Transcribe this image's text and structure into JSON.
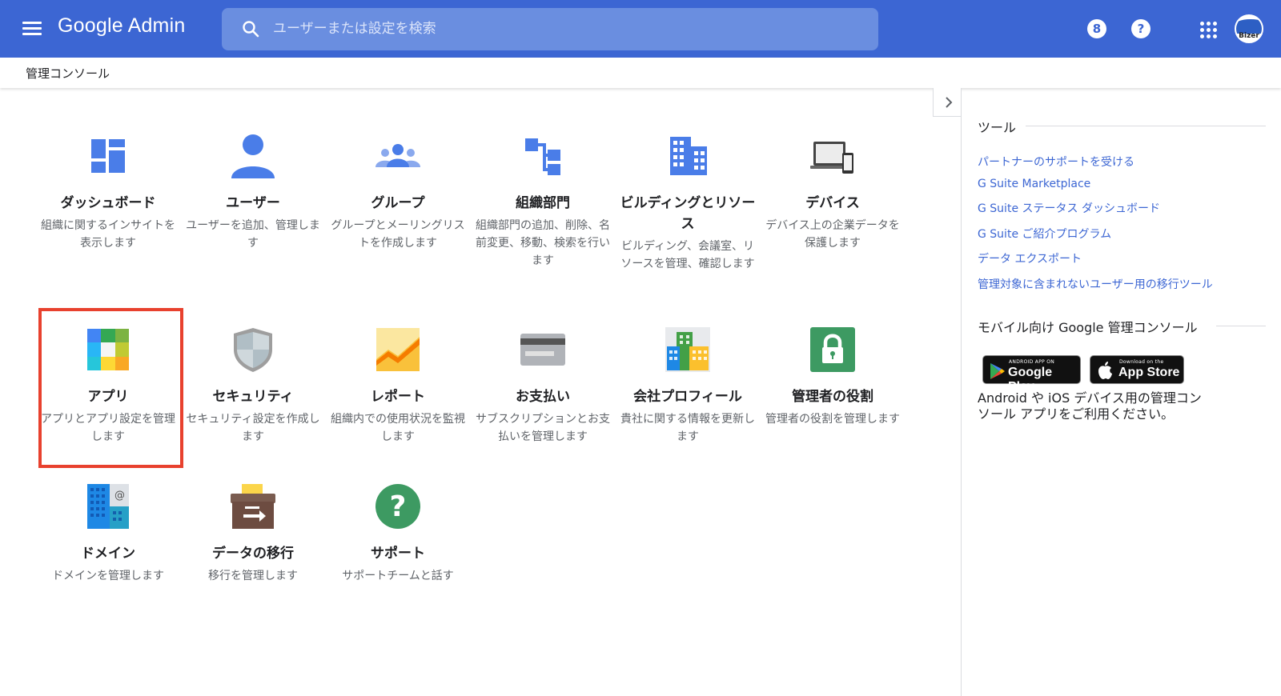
{
  "header": {
    "app_name": "Google Admin",
    "search_placeholder": "ユーザーまたは設定を検索",
    "notification_count": "8",
    "help_label": "?",
    "avatar_text": "Bizer"
  },
  "breadcrumb": "管理コンソール",
  "cards": [
    {
      "icon": "dashboard-icon",
      "title": "ダッシュボード",
      "desc": "組織に関するインサイトを表示します"
    },
    {
      "icon": "user-icon",
      "title": "ユーザー",
      "desc": "ユーザーを追加、管理します"
    },
    {
      "icon": "group-icon",
      "title": "グループ",
      "desc": "グループとメーリングリストを作成します"
    },
    {
      "icon": "org-unit-icon",
      "title": "組織部門",
      "desc": "組織部門の追加、削除、名前変更、移動、検索を行います"
    },
    {
      "icon": "building-icon",
      "title": "ビルディングとリソース",
      "desc": "ビルディング、会議室、リソースを管理、確認します"
    },
    {
      "icon": "devices-icon",
      "title": "デバイス",
      "desc": "デバイス上の企業データを保護します"
    },
    {
      "icon": "apps-icon",
      "title": "アプリ",
      "desc": "アプリとアプリ設定を管理します"
    },
    {
      "icon": "security-shield-icon",
      "title": "セキュリティ",
      "desc": "セキュリティ設定を作成します"
    },
    {
      "icon": "reports-chart-icon",
      "title": "レポート",
      "desc": "組織内での使用状況を監視します"
    },
    {
      "icon": "billing-card-icon",
      "title": "お支払い",
      "desc": "サブスクリプションとお支払いを管理します"
    },
    {
      "icon": "company-profile-icon",
      "title": "会社プロフィール",
      "desc": "貴社に関する情報を更新します"
    },
    {
      "icon": "admin-roles-lock-icon",
      "title": "管理者の役割",
      "desc": "管理者の役割を管理します"
    },
    {
      "icon": "domains-icon",
      "title": "ドメイン",
      "desc": "ドメインを管理します"
    },
    {
      "icon": "data-migration-icon",
      "title": "データの移行",
      "desc": "移行を管理します"
    },
    {
      "icon": "support-icon",
      "title": "サポート",
      "desc": "サポートチームと話す"
    }
  ],
  "sidepanel": {
    "tools_title": "ツール",
    "links": [
      "パートナーのサポートを受ける",
      "G Suite Marketplace",
      "G Suite ステータス ダッシュボード",
      "G Suite ご紹介プログラム",
      "データ エクスポート",
      "管理対象に含まれないユーザー用の移行ツール"
    ],
    "mobile_title": "モバイル向け Google 管理コンソール",
    "google_play_small": "ANDROID APP ON",
    "google_play_big": "Google Play",
    "app_store_small": "Download on the",
    "app_store_big": "App Store",
    "mobile_desc": "Android や iOS デバイス用の管理コンソール アプリをご利用ください。"
  },
  "colors": {
    "header_bg": "#3c66d3",
    "link": "#3c66d3",
    "highlight": "#e8412e"
  }
}
